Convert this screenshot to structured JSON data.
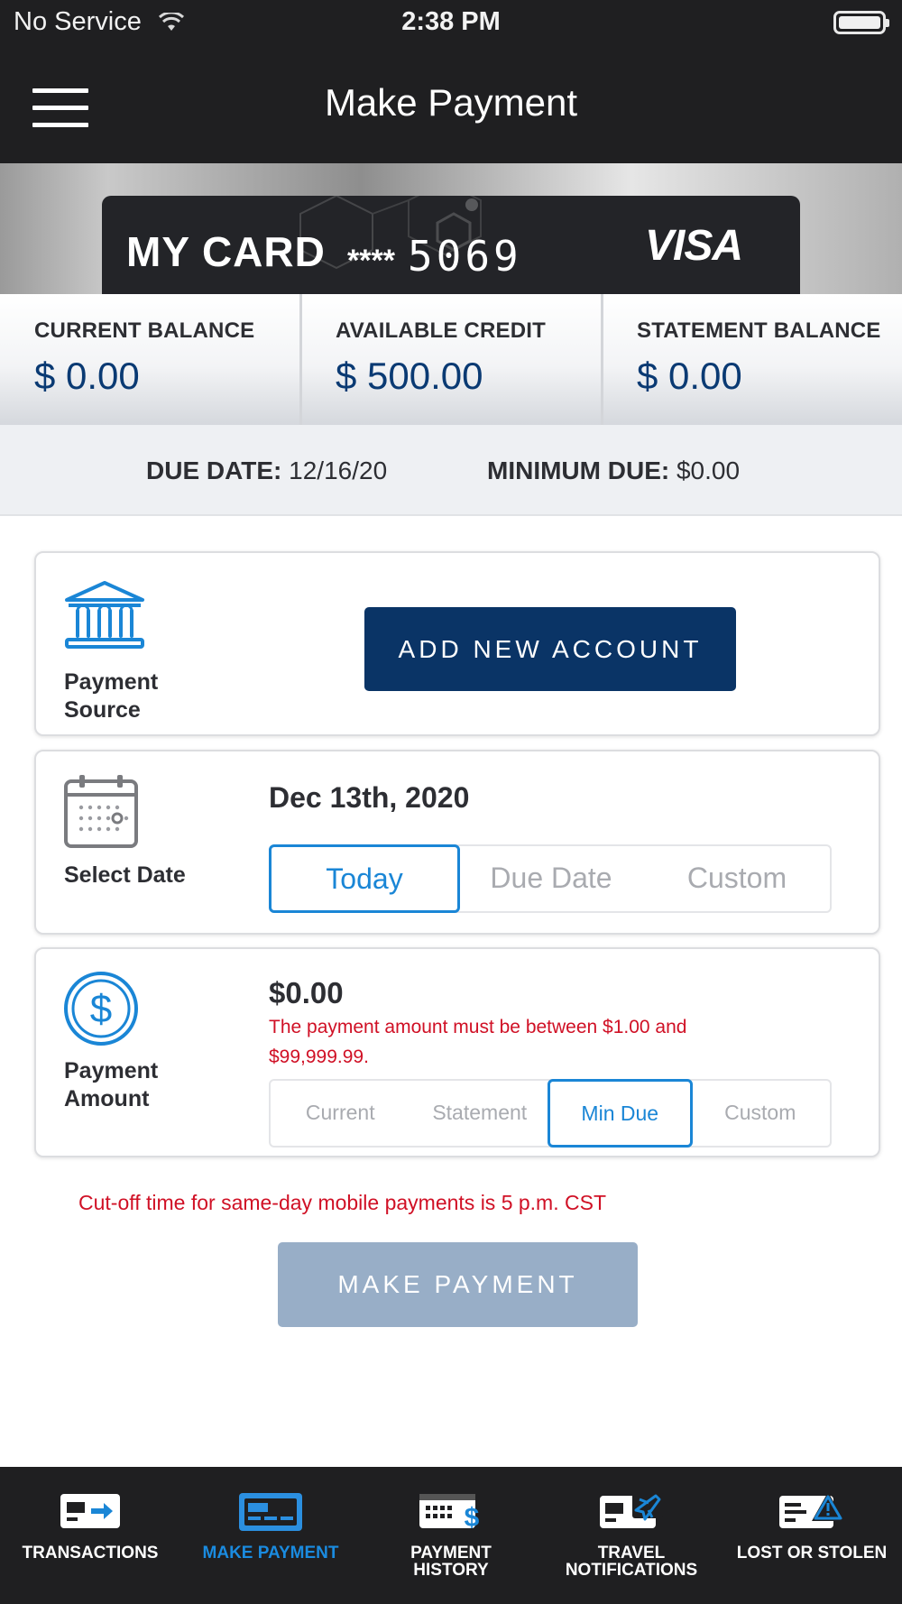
{
  "status_bar": {
    "carrier": "No Service",
    "time": "2:38 PM",
    "wifi_icon": "wifi-icon",
    "battery_icon": "battery-icon"
  },
  "nav": {
    "title": "Make Payment",
    "menu_icon": "hamburger-menu-icon"
  },
  "card": {
    "name": "MY CARD",
    "mask": "****",
    "last4": "5069",
    "network": "VISA"
  },
  "balances": [
    {
      "label": "CURRENT BALANCE",
      "value": "$ 0.00"
    },
    {
      "label": "AVAILABLE CREDIT",
      "value": "$ 500.00"
    },
    {
      "label": "STATEMENT BALANCE",
      "value": "$ 0.00"
    }
  ],
  "due": {
    "due_date_label": "DUE DATE:",
    "due_date_value": "12/16/20",
    "minimum_due_label": "MINIMUM DUE:",
    "minimum_due_value": "$0.00"
  },
  "payment_source": {
    "label_line1": "Payment",
    "label_line2": "Source",
    "icon": "bank-icon",
    "button": "ADD NEW ACCOUNT"
  },
  "select_date": {
    "label": "Select Date",
    "icon": "calendar-icon",
    "value": "Dec 13th, 2020",
    "options": [
      "Today",
      "Due Date",
      "Custom"
    ],
    "selected": "Today"
  },
  "payment_amount": {
    "label_line1": "Payment",
    "label_line2": "Amount",
    "icon": "dollar-circle-icon",
    "value": "$0.00",
    "error": "The payment amount must be between $1.00 and $99,999.99.",
    "options": [
      "Current",
      "Statement",
      "Min Due",
      "Custom"
    ],
    "selected": "Min Due"
  },
  "cutoff_notice": "Cut-off time for same-day mobile payments is 5 p.m. CST",
  "make_payment_button": "MAKE PAYMENT",
  "tab_bar": {
    "tabs": [
      {
        "line1": "TRANSACTIONS",
        "line2": "",
        "icon": "transactions-icon"
      },
      {
        "line1": "MAKE PAYMENT",
        "line2": "",
        "icon": "make-payment-icon"
      },
      {
        "line1": "PAYMENT",
        "line2": "HISTORY",
        "icon": "payment-history-icon"
      },
      {
        "line1": "TRAVEL",
        "line2": "NOTIFICATIONS",
        "icon": "travel-notifications-icon"
      },
      {
        "line1": "LOST OR STOLEN",
        "line2": "",
        "icon": "lost-or-stolen-icon"
      }
    ],
    "active": "MAKE PAYMENT"
  },
  "colors": {
    "navy": "#0a3466",
    "accent_blue": "#1a86d6",
    "error_red": "#d01025",
    "disabled_button": "#98aec7",
    "dark_bar": "#1f1f21"
  }
}
